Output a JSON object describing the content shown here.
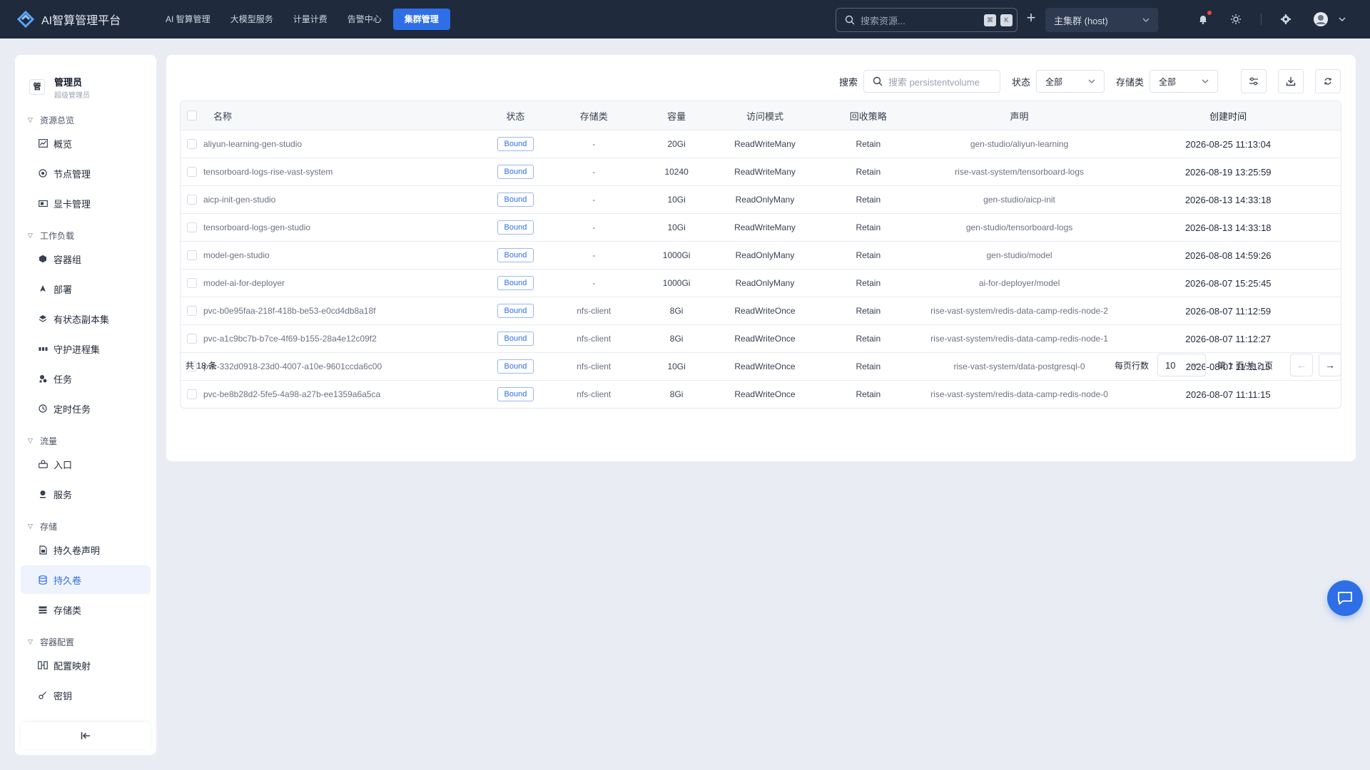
{
  "app": {
    "title": "AI智算管理平台"
  },
  "nav": {
    "items": [
      "AI 智算管理",
      "大模型服务",
      "计量计费",
      "告警中心"
    ],
    "active": "集群管理"
  },
  "top": {
    "search_placeholder": "搜索资源...",
    "kbd1": "⌘",
    "kbd2": "K",
    "cluster": "主集群 (host)"
  },
  "user": {
    "avatar": "管",
    "name": "管理员",
    "role": "超级管理员"
  },
  "sidebar": {
    "groups": [
      {
        "title": "资源总览",
        "items": [
          {
            "label": "概览",
            "icon": "chart-icon"
          },
          {
            "label": "节点管理",
            "icon": "node-icon"
          },
          {
            "label": "显卡管理",
            "icon": "gpu-icon"
          }
        ]
      },
      {
        "title": "工作负载",
        "items": [
          {
            "label": "容器组",
            "icon": "cube-icon"
          },
          {
            "label": "部署",
            "icon": "deploy-icon"
          },
          {
            "label": "有状态副本集",
            "icon": "layers-icon"
          },
          {
            "label": "守护进程集",
            "icon": "daemon-icon"
          },
          {
            "label": "任务",
            "icon": "job-icon"
          },
          {
            "label": "定时任务",
            "icon": "clock-icon"
          }
        ]
      },
      {
        "title": "流量",
        "items": [
          {
            "label": "入口",
            "icon": "ingress-icon"
          },
          {
            "label": "服务",
            "icon": "service-icon"
          }
        ]
      },
      {
        "title": "存储",
        "items": [
          {
            "label": "持久卷声明",
            "icon": "pvc-icon"
          },
          {
            "label": "持久卷",
            "icon": "database-icon",
            "active": true
          },
          {
            "label": "存储类",
            "icon": "storage-icon"
          }
        ]
      },
      {
        "title": "容器配置",
        "items": [
          {
            "label": "配置映射",
            "icon": "configmap-icon"
          },
          {
            "label": "密钥",
            "icon": "key-icon"
          }
        ]
      }
    ]
  },
  "filters": {
    "search_label": "搜索",
    "search_placeholder": "搜索 persistentvolume",
    "status_label": "状态",
    "status_value": "全部",
    "sc_label": "存储类",
    "sc_value": "全部"
  },
  "table": {
    "headers": [
      "名称",
      "状态",
      "存储类",
      "容量",
      "访问模式",
      "回收策略",
      "声明",
      "创建时间"
    ],
    "rows": [
      [
        "aliyun-learning-gen-studio",
        "Bound",
        "-",
        "20Gi",
        "ReadWriteMany",
        "Retain",
        "gen-studio/aliyun-learning",
        "2026-08-25 11:13:04"
      ],
      [
        "tensorboard-logs-rise-vast-system",
        "Bound",
        "-",
        "10240",
        "ReadWriteMany",
        "Retain",
        "rise-vast-system/tensorboard-logs",
        "2026-08-19 13:25:59"
      ],
      [
        "aicp-init-gen-studio",
        "Bound",
        "-",
        "10Gi",
        "ReadOnlyMany",
        "Retain",
        "gen-studio/aicp-init",
        "2026-08-13 14:33:18"
      ],
      [
        "tensorboard-logs-gen-studio",
        "Bound",
        "-",
        "10Gi",
        "ReadWriteMany",
        "Retain",
        "gen-studio/tensorboard-logs",
        "2026-08-13 14:33:18"
      ],
      [
        "model-gen-studio",
        "Bound",
        "-",
        "1000Gi",
        "ReadOnlyMany",
        "Retain",
        "gen-studio/model",
        "2026-08-08 14:59:26"
      ],
      [
        "model-ai-for-deployer",
        "Bound",
        "-",
        "1000Gi",
        "ReadOnlyMany",
        "Retain",
        "ai-for-deployer/model",
        "2026-08-07 15:25:45"
      ],
      [
        "pvc-b0e95faa-218f-418b-be53-e0cd4db8a18f",
        "Bound",
        "nfs-client",
        "8Gi",
        "ReadWriteOnce",
        "Retain",
        "rise-vast-system/redis-data-camp-redis-node-2",
        "2026-08-07 11:12:59"
      ],
      [
        "pvc-a1c9bc7b-b7ce-4f69-b155-28a4e12c09f2",
        "Bound",
        "nfs-client",
        "8Gi",
        "ReadWriteOnce",
        "Retain",
        "rise-vast-system/redis-data-camp-redis-node-1",
        "2026-08-07 11:12:27"
      ],
      [
        "pvc-332d0918-23d0-4007-a10e-9601ccda6c00",
        "Bound",
        "nfs-client",
        "10Gi",
        "ReadWriteOnce",
        "Retain",
        "rise-vast-system/data-postgresql-0",
        "2026-08-07 11:11:15"
      ],
      [
        "pvc-be8b28d2-5fe5-4a98-a27b-ee1359a6a5ca",
        "Bound",
        "nfs-client",
        "8Gi",
        "ReadWriteOnce",
        "Retain",
        "rise-vast-system/redis-data-camp-redis-node-0",
        "2026-08-07 11:11:15"
      ]
    ]
  },
  "footer": {
    "total": "共 18 条",
    "per_page_label": "每页行数",
    "per_page": "10",
    "page_info": "第 1 页/共 2 页",
    "prev": "←",
    "next": "→"
  },
  "colors": {
    "topbar": "#1f2a3c",
    "accent": "#2e6fe8",
    "background": "#e9edf3"
  }
}
